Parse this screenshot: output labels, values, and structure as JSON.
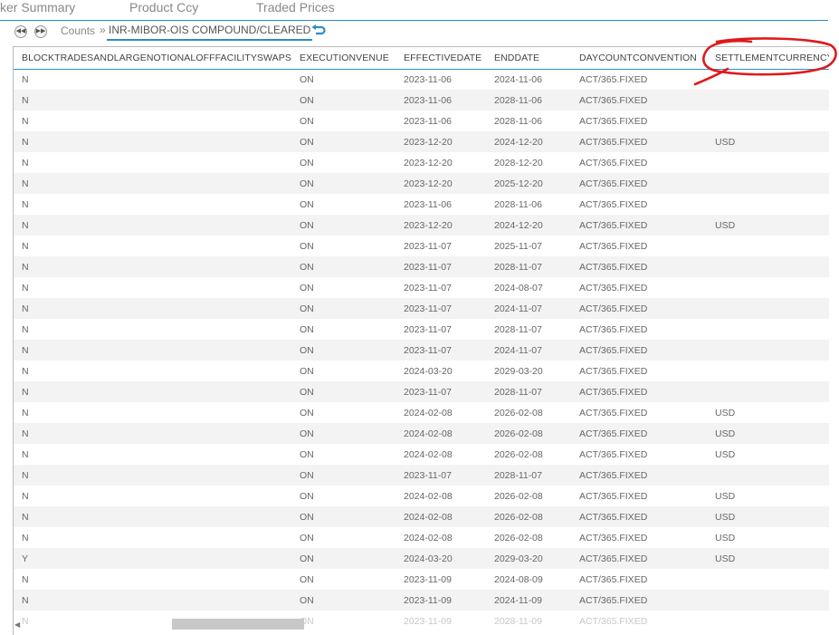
{
  "top_tabs": [
    "ker Summary",
    "Product Ccy",
    "Traded Prices"
  ],
  "breadcrumb": {
    "counts_label": "Counts",
    "separator": "»",
    "current": "INR-MIBOR-OIS COMPOUND/CLEARED"
  },
  "icons": {
    "prev": "rewind-icon",
    "next": "fast-forward-icon",
    "back": "undo-arrow-icon"
  },
  "columns": [
    "BLOCKTRADESANDLARGENOTIONALOFFFACILITYSWAPS",
    "EXECUTIONVENUE",
    "EFFECTIVEDATE",
    "ENDDATE",
    "DAYCOUNTCONVENTION",
    "SETTLEMENTCURRENCY"
  ],
  "rows": [
    [
      "N",
      "ON",
      "2023-11-06",
      "2024-11-06",
      "ACT/365.FIXED",
      ""
    ],
    [
      "N",
      "ON",
      "2023-11-06",
      "2028-11-06",
      "ACT/365.FIXED",
      ""
    ],
    [
      "N",
      "ON",
      "2023-11-06",
      "2028-11-06",
      "ACT/365.FIXED",
      ""
    ],
    [
      "N",
      "ON",
      "2023-12-20",
      "2024-12-20",
      "ACT/365.FIXED",
      "USD"
    ],
    [
      "N",
      "ON",
      "2023-12-20",
      "2028-12-20",
      "ACT/365.FIXED",
      ""
    ],
    [
      "N",
      "ON",
      "2023-12-20",
      "2025-12-20",
      "ACT/365.FIXED",
      ""
    ],
    [
      "N",
      "ON",
      "2023-11-06",
      "2028-11-06",
      "ACT/365.FIXED",
      ""
    ],
    [
      "N",
      "ON",
      "2023-12-20",
      "2024-12-20",
      "ACT/365.FIXED",
      "USD"
    ],
    [
      "N",
      "ON",
      "2023-11-07",
      "2025-11-07",
      "ACT/365.FIXED",
      ""
    ],
    [
      "N",
      "ON",
      "2023-11-07",
      "2028-11-07",
      "ACT/365.FIXED",
      ""
    ],
    [
      "N",
      "ON",
      "2023-11-07",
      "2024-08-07",
      "ACT/365.FIXED",
      ""
    ],
    [
      "N",
      "ON",
      "2023-11-07",
      "2024-11-07",
      "ACT/365.FIXED",
      ""
    ],
    [
      "N",
      "ON",
      "2023-11-07",
      "2028-11-07",
      "ACT/365.FIXED",
      ""
    ],
    [
      "N",
      "ON",
      "2023-11-07",
      "2024-11-07",
      "ACT/365.FIXED",
      ""
    ],
    [
      "N",
      "ON",
      "2024-03-20",
      "2029-03-20",
      "ACT/365.FIXED",
      ""
    ],
    [
      "N",
      "ON",
      "2023-11-07",
      "2028-11-07",
      "ACT/365.FIXED",
      ""
    ],
    [
      "N",
      "ON",
      "2024-02-08",
      "2026-02-08",
      "ACT/365.FIXED",
      "USD"
    ],
    [
      "N",
      "ON",
      "2024-02-08",
      "2026-02-08",
      "ACT/365.FIXED",
      "USD"
    ],
    [
      "N",
      "ON",
      "2024-02-08",
      "2026-02-08",
      "ACT/365.FIXED",
      "USD"
    ],
    [
      "N",
      "ON",
      "2023-11-07",
      "2028-11-07",
      "ACT/365.FIXED",
      ""
    ],
    [
      "N",
      "ON",
      "2024-02-08",
      "2026-02-08",
      "ACT/365.FIXED",
      "USD"
    ],
    [
      "N",
      "ON",
      "2024-02-08",
      "2026-02-08",
      "ACT/365.FIXED",
      "USD"
    ],
    [
      "N",
      "ON",
      "2024-02-08",
      "2026-02-08",
      "ACT/365.FIXED",
      "USD"
    ],
    [
      "Y",
      "ON",
      "2024-03-20",
      "2029-03-20",
      "ACT/365.FIXED",
      "USD"
    ],
    [
      "N",
      "ON",
      "2023-11-09",
      "2024-08-09",
      "ACT/365.FIXED",
      ""
    ],
    [
      "N",
      "ON",
      "2023-11-09",
      "2024-11-09",
      "ACT/365.FIXED",
      ""
    ],
    [
      "N",
      "ON",
      "2023-11-09",
      "2028-11-09",
      "ACT/365.FIXED",
      ""
    ]
  ],
  "colors": {
    "accent": "#2e8bc9",
    "annotation": "#e0191c",
    "row_alt": "#f3f3f3"
  }
}
